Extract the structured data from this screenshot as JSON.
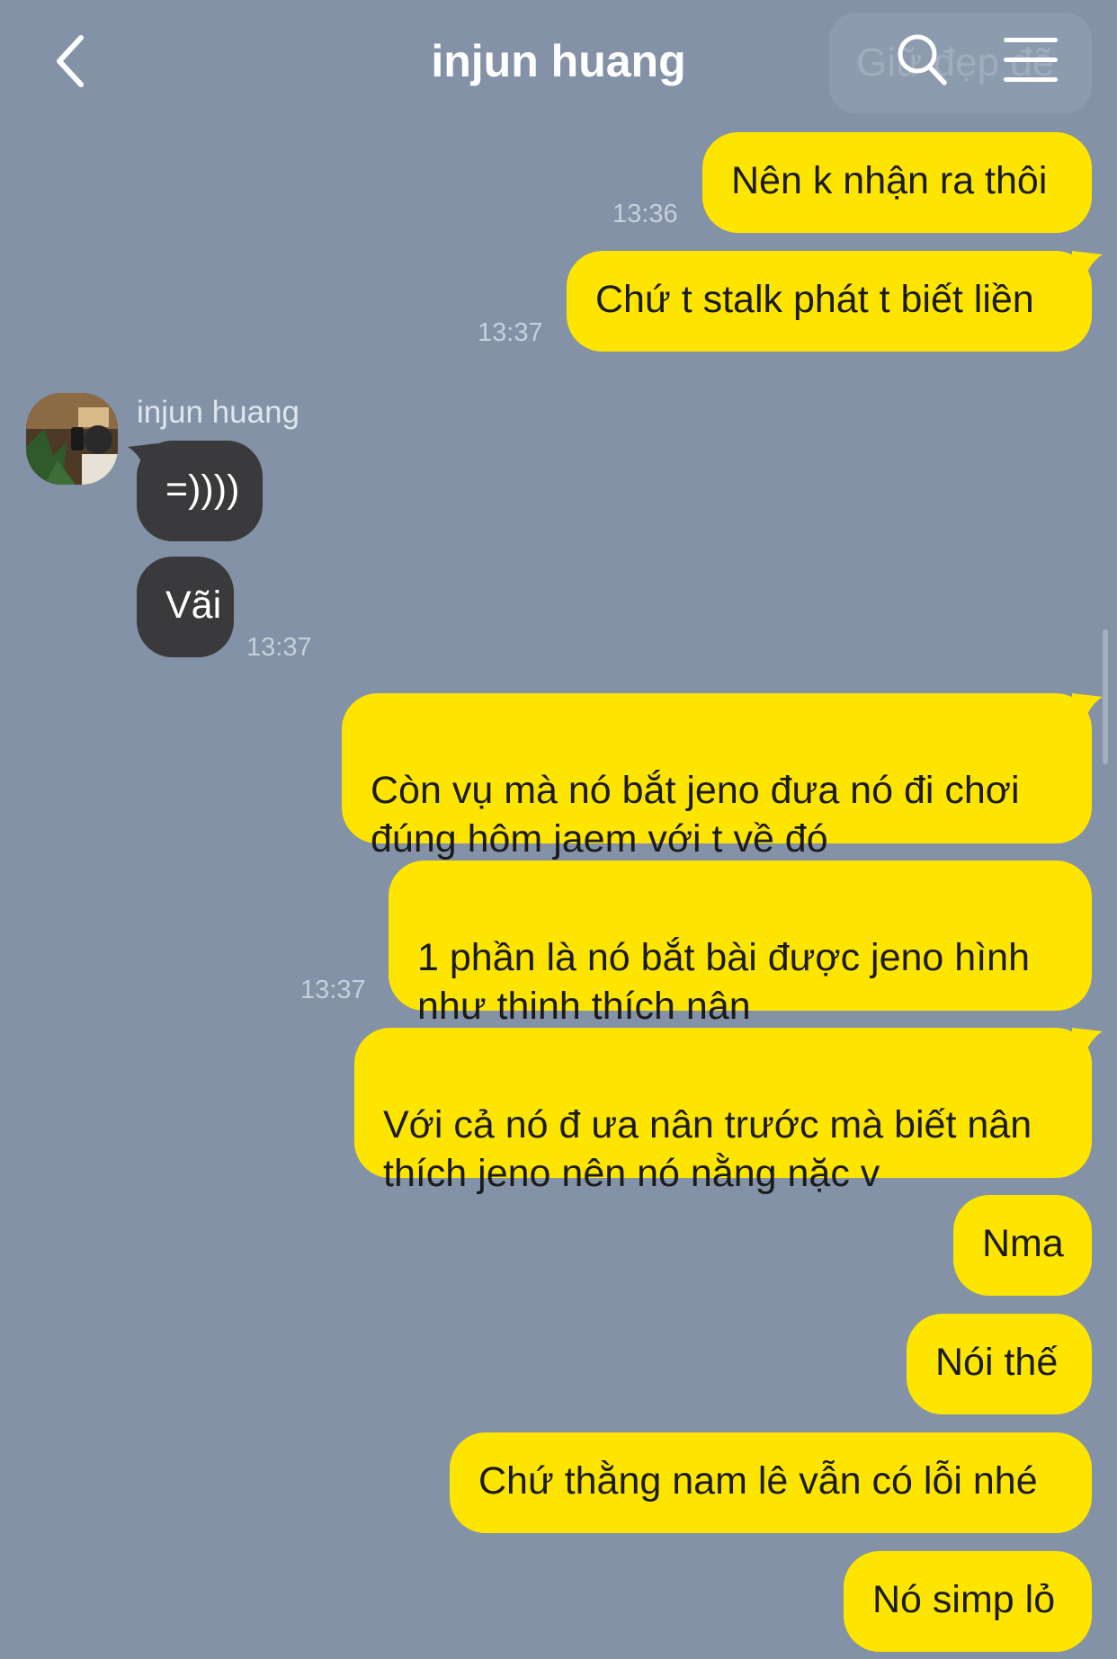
{
  "header": {
    "title": "injun huang",
    "save_label": "Giữ đẹp đẽ"
  },
  "messages": [
    {
      "text": "Nên k nhận ra thôi",
      "time": "13:36"
    },
    {
      "text": "Chứ t stalk phát t biết liền",
      "time": "13:37"
    },
    {
      "sender": "injun huang",
      "text": "=))))"
    },
    {
      "text": "Vãi",
      "time": "13:37"
    },
    {
      "text": "Còn vụ mà nó bắt jeno đưa nó đi chơi\nđúng hôm jaem với t về đó"
    },
    {
      "text": "1 phần là nó bắt bài được jeno hình\nnhư thinh thích nân",
      "time": "13:37"
    },
    {
      "text": "Với cả nó đ ưa nân trước mà biết nân\nthích jeno nên nó nằng nặc v"
    },
    {
      "text": "Nma"
    },
    {
      "text": "Nói thế"
    },
    {
      "text": "Chứ thằng nam lê vẫn có lỗi nhé"
    },
    {
      "text": "Nó simp lỏ"
    }
  ],
  "icons": {
    "back": "chevron-left-icon",
    "search": "search-icon",
    "menu": "hamburger-menu-icon"
  },
  "colors": {
    "background": "#8392a6",
    "my_bubble": "#fee500",
    "their_bubble": "#3a3a3c",
    "time_text": "#c7cfda"
  }
}
